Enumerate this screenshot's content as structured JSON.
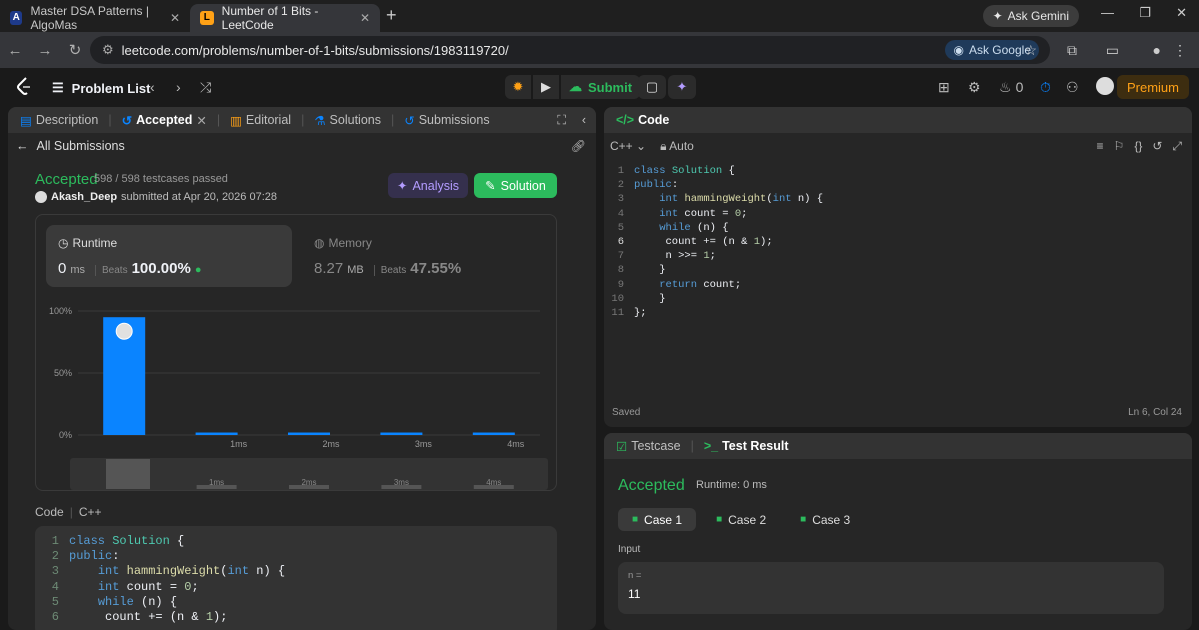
{
  "browser": {
    "tabs": [
      {
        "title": "Master DSA Patterns | AlgoMas",
        "favicon": "A"
      },
      {
        "title": "Number of 1 Bits - LeetCode",
        "favicon": "L"
      }
    ],
    "url": "leetcode.com/problems/number-of-1-bits/submissions/1983119720/",
    "ask_gemini": "Ask Gemini",
    "ask_google": "Ask Google"
  },
  "header": {
    "problem_list": "Problem List",
    "submit": "Submit",
    "streak": "0",
    "premium": "Premium"
  },
  "left_tabs": [
    "Description",
    "Accepted",
    "Editorial",
    "Solutions",
    "Submissions"
  ],
  "submission": {
    "back_label": "All Submissions",
    "status": "Accepted",
    "passed": "598 / 598 testcases passed",
    "user": "Akash_Deep",
    "submitted_at": "submitted at Apr 20, 2026 07:28",
    "analysis": "Analysis",
    "solution": "Solution",
    "runtime_label": "Runtime",
    "runtime_value": "0",
    "runtime_unit": "ms",
    "runtime_beats_label": "Beats",
    "runtime_beats": "100.00%",
    "memory_label": "Memory",
    "memory_value": "8.27",
    "memory_unit": "MB",
    "memory_beats_label": "Beats",
    "memory_beats": "47.55%",
    "code_label": "Code",
    "code_lang": "C++"
  },
  "chart_data": {
    "type": "bar",
    "categories": [
      "",
      "1ms",
      "2ms",
      "3ms",
      "4ms"
    ],
    "values": [
      95,
      2,
      2,
      2,
      2
    ],
    "ytick_labels": [
      "100%",
      "50%",
      "0%"
    ],
    "ylim": [
      0,
      100
    ],
    "bar_color": "#0a84ff",
    "grid": true
  },
  "code_lines": [
    "class Solution {",
    "public:",
    "    int hammingWeight(int n) {",
    "    int count = 0;",
    "    while (n) {",
    "     count += (n & 1);",
    "     n >>= 1;",
    "    }",
    "    return count;",
    "    }",
    "};"
  ],
  "editor": {
    "title": "Code",
    "lang": "C++",
    "mode": "Auto",
    "saved": "Saved",
    "cursor": "Ln 6, Col 24"
  },
  "test": {
    "tab_testcase": "Testcase",
    "tab_result": "Test Result",
    "status": "Accepted",
    "runtime": "Runtime: 0 ms",
    "cases": [
      "Case 1",
      "Case 2",
      "Case 3"
    ],
    "input_label": "Input",
    "var_name": "n =",
    "var_value": "11"
  }
}
